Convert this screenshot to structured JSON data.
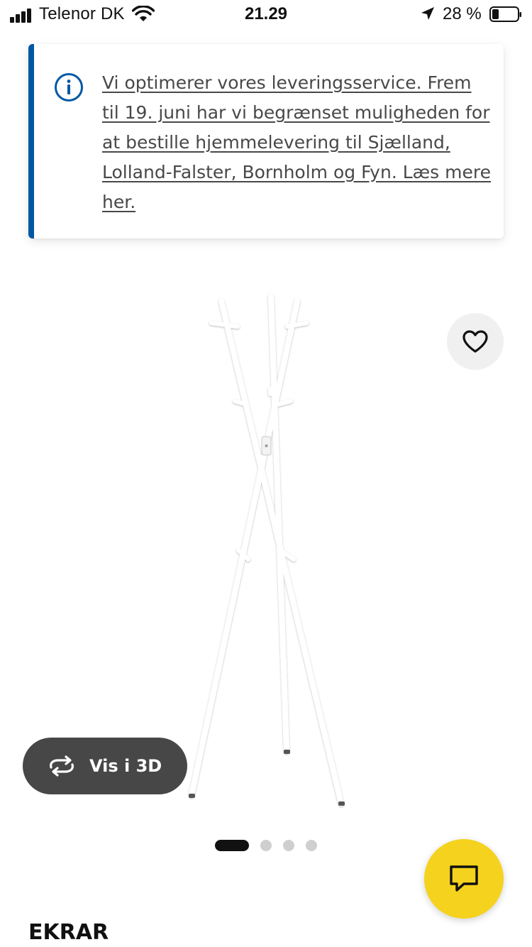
{
  "status_bar": {
    "carrier": "Telenor DK",
    "time": "21.29",
    "battery_percent": "28 %",
    "icons": [
      "signal-icon",
      "wifi-icon",
      "location-arrow-icon",
      "battery-icon"
    ]
  },
  "banner": {
    "icon": "info-icon",
    "text": "Vi optimerer vores leveringsservice. Frem til 19. juni har vi begrænset muligheden for at bestille hjemmelevering til Sjælland, Lolland-Falster, Bornholm og Fyn. Læs mere her.",
    "accent_color": "#0058a3"
  },
  "product": {
    "image_alt": "coat-stand",
    "favorite_icon": "heart-icon",
    "view3d_icon": "rotate-3d-icon",
    "view3d_label": "Vis i 3D",
    "name": "EKRAR"
  },
  "carousel": {
    "count": 4,
    "active_index": 0
  },
  "chat": {
    "icon": "chat-icon",
    "color": "#f5d21d"
  }
}
